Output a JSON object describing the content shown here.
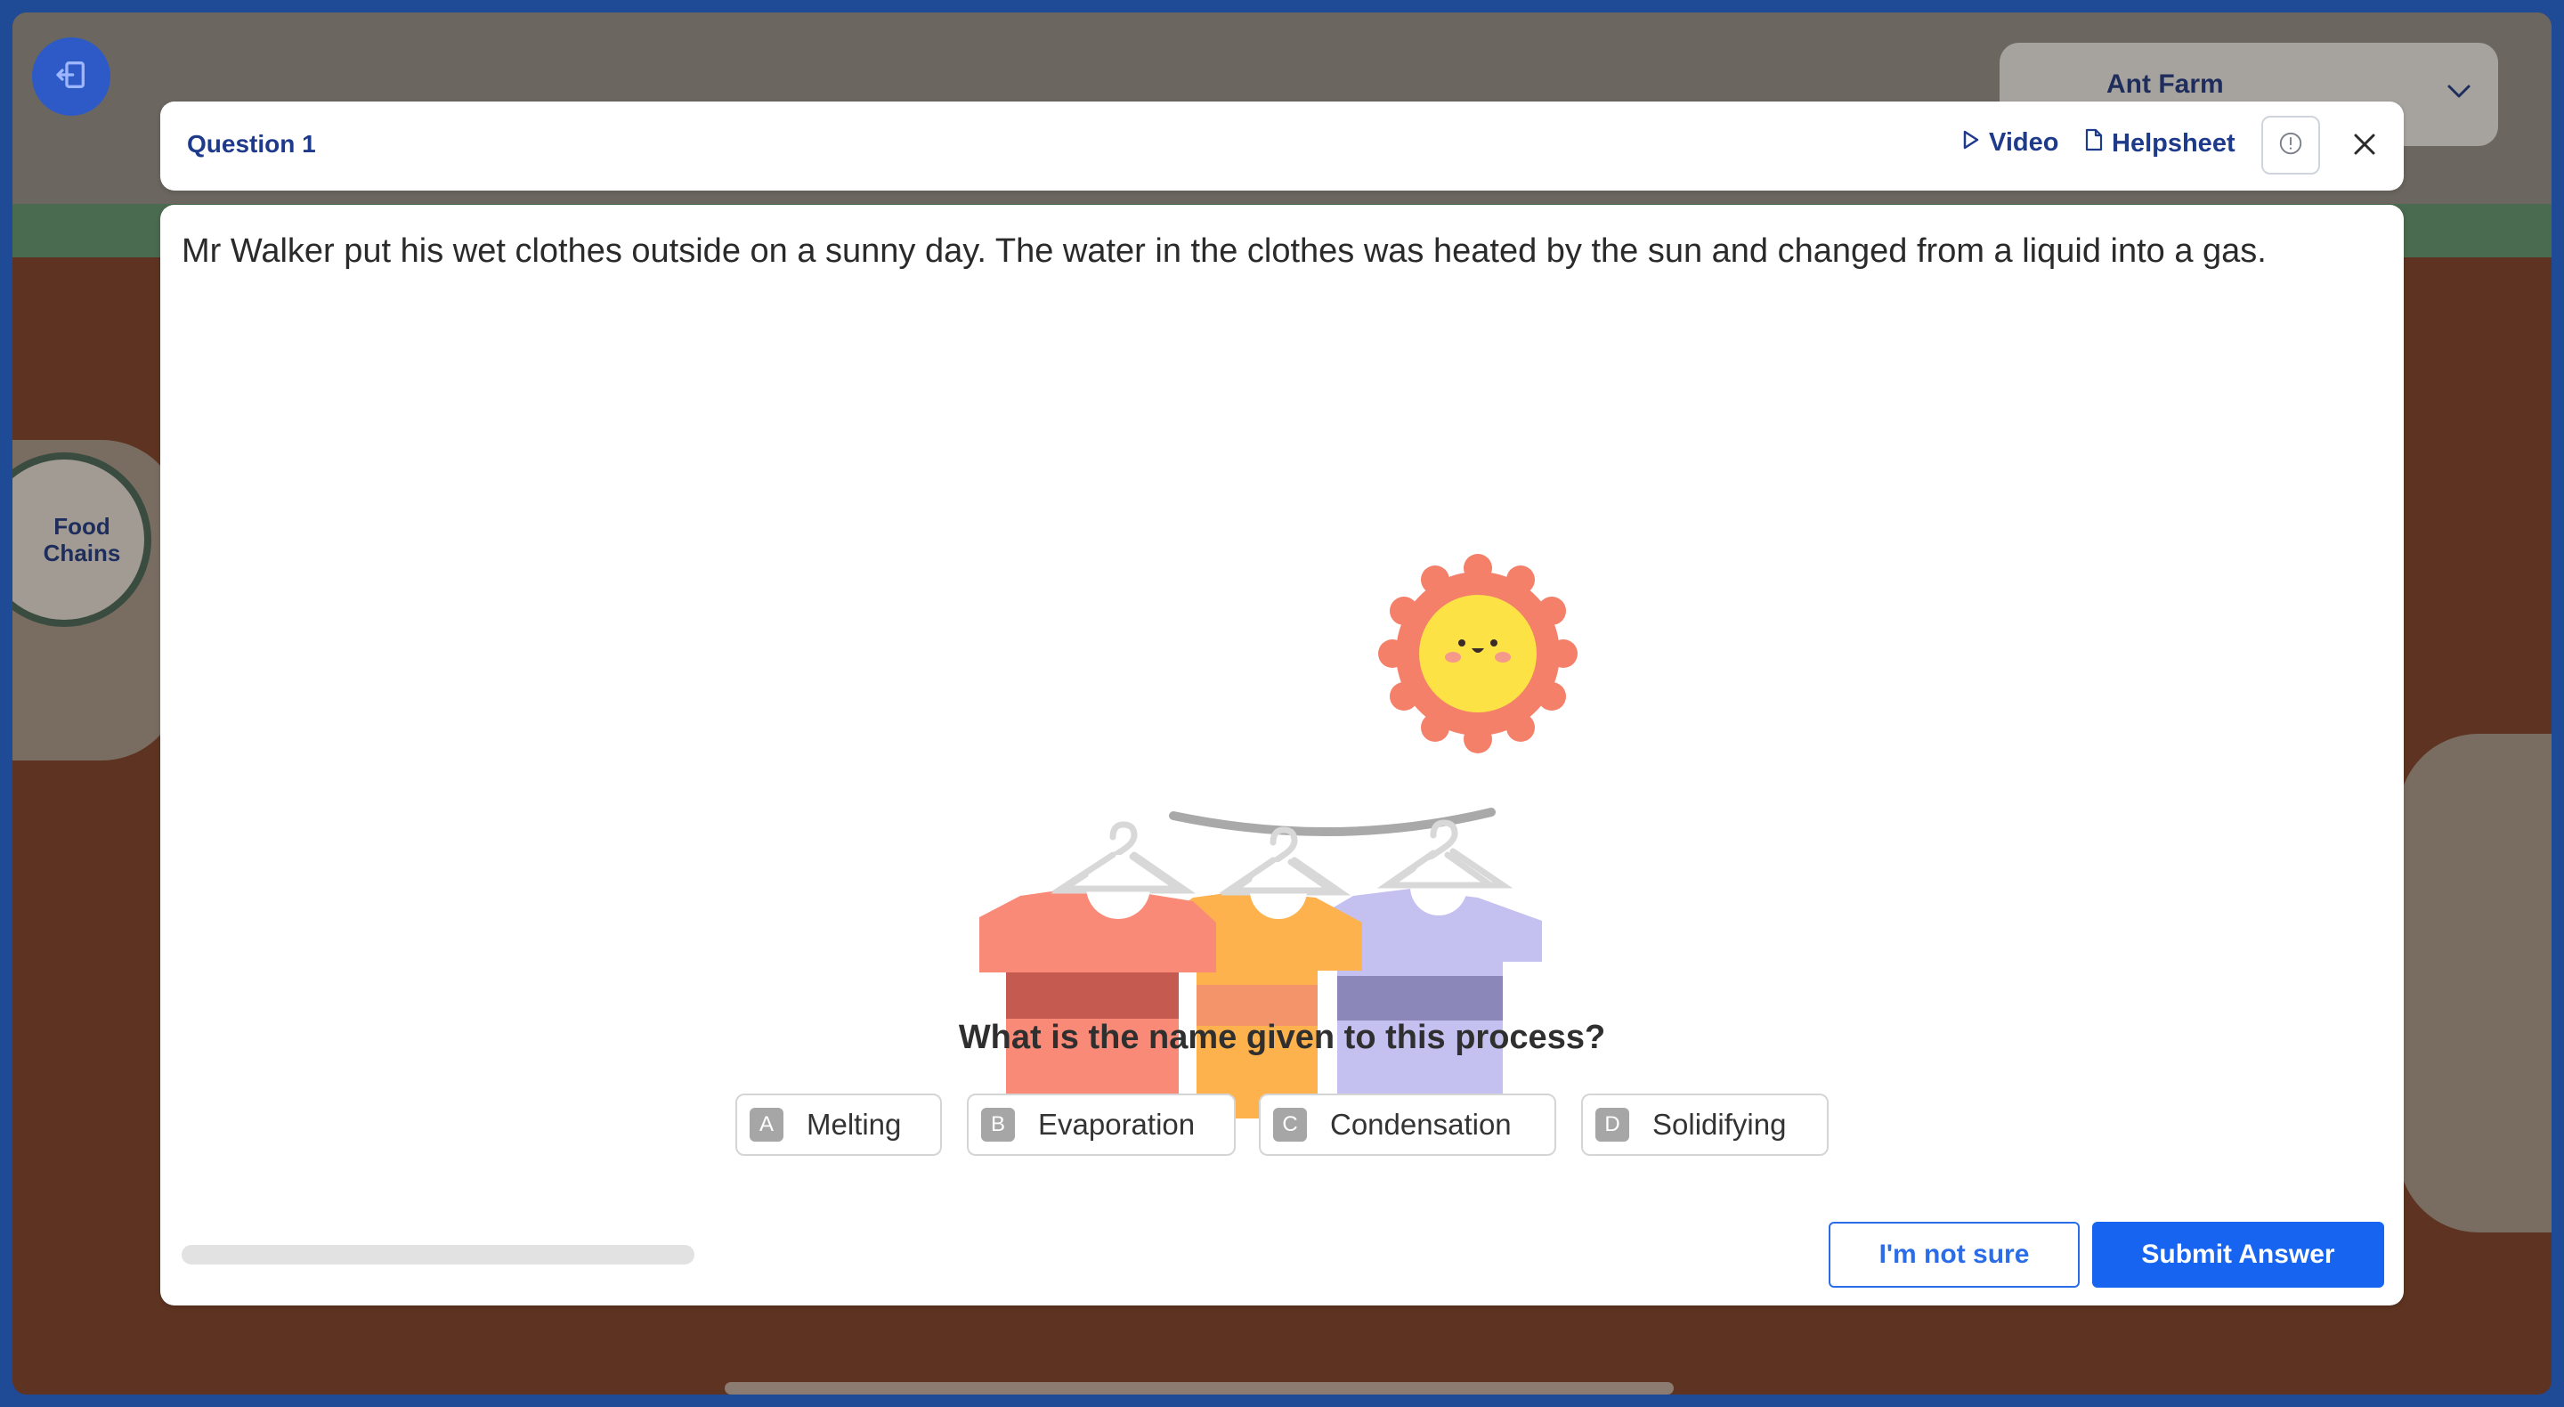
{
  "background": {
    "topic_name": "Ant Farm",
    "map_node_label": "Food Chains"
  },
  "header": {
    "question_title": "Question 1",
    "video_label": "Video",
    "helpsheet_label": "Helpsheet"
  },
  "question": {
    "stem": "Mr Walker put his wet clothes outside on a sunny day. The water in the clothes was heated by the sun and changed from a liquid into a gas.",
    "prompt": "What is the name given to this process?",
    "options": [
      {
        "letter": "A",
        "label": "Melting"
      },
      {
        "letter": "B",
        "label": "Evaporation"
      },
      {
        "letter": "C",
        "label": "Condensation"
      },
      {
        "letter": "D",
        "label": "Solidifying"
      }
    ],
    "progress": 0
  },
  "actions": {
    "not_sure_label": "I'm not sure",
    "submit_label": "Submit Answer"
  },
  "colors": {
    "accent": "#1664f0",
    "title_blue": "#1e3a8a",
    "shirt_red": "#fa8a78",
    "shirt_orange": "#fdb24e",
    "shirt_purple": "#c4c0f0",
    "sun_petals": "#f4806a",
    "sun_face": "#fde246"
  },
  "icons": [
    "exit-icon",
    "chevron-down-icon",
    "play-icon",
    "document-icon",
    "info-icon",
    "close-icon"
  ]
}
